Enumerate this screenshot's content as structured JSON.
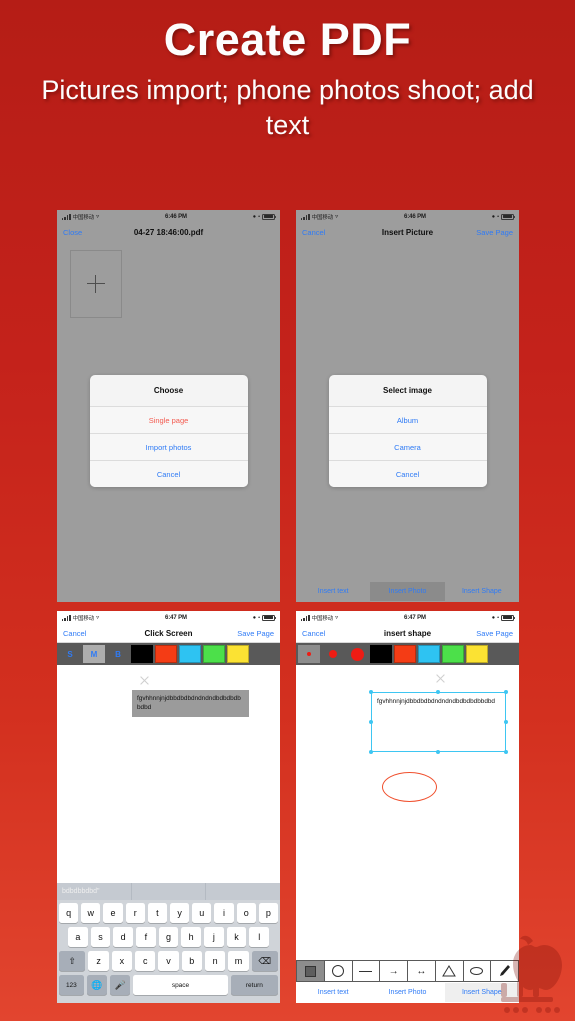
{
  "header": {
    "title": "Create PDF",
    "subtitle": "Pictures import; phone photos shoot; add text"
  },
  "colors": {
    "background_top": "#b51d16",
    "background_bottom": "#e2452f",
    "ios_blue": "#2f7bf6",
    "ios_red": "#f35a4f",
    "selection_cyan": "#3ec6f2",
    "shape_orange": "#f0502e",
    "swatch_black": "#000000",
    "swatch_red": "#f43c15",
    "swatch_cyan": "#2ec3f2",
    "swatch_green": "#4ce04a",
    "swatch_yellow": "#fbe233"
  },
  "phones": [
    {
      "id": "phone-create-pdf",
      "statusbar": {
        "carrier": "中国移动",
        "time": "6:46 PM",
        "wifi_icon": "wifi-icon",
        "signal_icon": "signal-bars-icon",
        "battery_icon": "battery-icon",
        "alarm_icon": "alarm-icon",
        "lock_icon": "lock-icon"
      },
      "navbar": {
        "left": "Close",
        "title": "04-27 18:46:00.pdf",
        "right": ""
      },
      "add_page_icon": "plus-icon",
      "alert": {
        "title": "Choose",
        "options": [
          {
            "label": "Single page",
            "style": "danger"
          },
          {
            "label": "Import photos",
            "style": "normal"
          },
          {
            "label": "Cancel",
            "style": "normal"
          }
        ]
      }
    },
    {
      "id": "phone-insert-picture",
      "statusbar": {
        "carrier": "中国移动",
        "time": "6:46 PM",
        "wifi_icon": "wifi-icon",
        "signal_icon": "signal-bars-icon",
        "battery_icon": "battery-icon",
        "alarm_icon": "alarm-icon",
        "lock_icon": "lock-icon"
      },
      "navbar": {
        "left": "Cancel",
        "title": "Insert Picture",
        "right": "Save Page"
      },
      "alert": {
        "title": "Select image",
        "options": [
          {
            "label": "Album",
            "style": "normal"
          },
          {
            "label": "Camera",
            "style": "normal"
          },
          {
            "label": "Cancel",
            "style": "normal"
          }
        ]
      },
      "tabs": [
        {
          "label": "Insert text",
          "active": false
        },
        {
          "label": "Insert Photo",
          "active": true
        },
        {
          "label": "Insert Shape",
          "active": false
        }
      ]
    },
    {
      "id": "phone-click-screen",
      "statusbar": {
        "carrier": "中国移动",
        "time": "6:47 PM",
        "wifi_icon": "wifi-icon",
        "signal_icon": "signal-bars-icon",
        "battery_icon": "battery-icon",
        "alarm_icon": "alarm-icon",
        "lock_icon": "lock-icon"
      },
      "navbar": {
        "left": "Cancel",
        "title": "Click Screen",
        "right": "Save Page"
      },
      "style_toolbar": {
        "sizes": [
          {
            "label": "S",
            "selected": false
          },
          {
            "label": "M",
            "selected": true
          },
          {
            "label": "B",
            "selected": false
          }
        ],
        "swatches": [
          "#000000",
          "#f43c15",
          "#2ec3f2",
          "#4ce04a",
          "#fbe233"
        ]
      },
      "textbox": {
        "text": "fgvhhnnjnjdbbdbdbdndndndbdbdbdbbdbd",
        "close_icon": "close-x-icon"
      },
      "keyboard": {
        "predictions": [
          "bdbdbbdbd\"",
          "",
          ""
        ],
        "row1": [
          "q",
          "w",
          "e",
          "r",
          "t",
          "y",
          "u",
          "i",
          "o",
          "p"
        ],
        "row2": [
          "a",
          "s",
          "d",
          "f",
          "g",
          "h",
          "j",
          "k",
          "l"
        ],
        "row3": [
          "z",
          "x",
          "c",
          "v",
          "b",
          "n",
          "m"
        ],
        "shift_icon": "shift-icon",
        "backspace_icon": "backspace-icon",
        "numbers_key": "123",
        "globe_icon": "globe-icon",
        "mic_icon": "microphone-icon",
        "space_key": "space",
        "return_key": "return"
      }
    },
    {
      "id": "phone-insert-shape",
      "statusbar": {
        "carrier": "中国移动",
        "time": "6:47 PM",
        "wifi_icon": "wifi-icon",
        "signal_icon": "signal-bars-icon",
        "battery_icon": "battery-icon",
        "alarm_icon": "alarm-icon",
        "lock_icon": "lock-icon"
      },
      "navbar": {
        "left": "Cancel",
        "title": "insert shape",
        "right": "Save Page"
      },
      "style_toolbar": {
        "dots": [
          {
            "size": "small",
            "selected": true
          },
          {
            "size": "medium",
            "selected": false
          },
          {
            "size": "large",
            "selected": false
          }
        ],
        "swatches": [
          "#000000",
          "#f43c15",
          "#2ec3f2",
          "#4ce04a",
          "#fbe233"
        ]
      },
      "textbox": {
        "text": "fgvhhnnjnjdbbdbdbdndndndbdbdbdbbdbd",
        "close_icon": "close-x-icon",
        "selected": true
      },
      "ellipse_shape": "ellipse-shape",
      "shape_tools": [
        {
          "icon": "square-icon",
          "selected": true
        },
        {
          "icon": "circle-icon",
          "selected": false
        },
        {
          "icon": "line-icon",
          "selected": false
        },
        {
          "icon": "arrow-icon",
          "selected": false
        },
        {
          "icon": "double-arrow-icon",
          "selected": false
        },
        {
          "icon": "triangle-icon",
          "selected": false
        },
        {
          "icon": "ellipse-icon",
          "selected": false
        },
        {
          "icon": "pen-icon",
          "selected": false
        }
      ],
      "tabs": [
        {
          "label": "Insert text",
          "active": false
        },
        {
          "label": "Insert Photo",
          "active": false
        },
        {
          "label": "Insert Shape",
          "active": true
        }
      ]
    }
  ],
  "watermark": {
    "name": "sibapp-watermark"
  }
}
